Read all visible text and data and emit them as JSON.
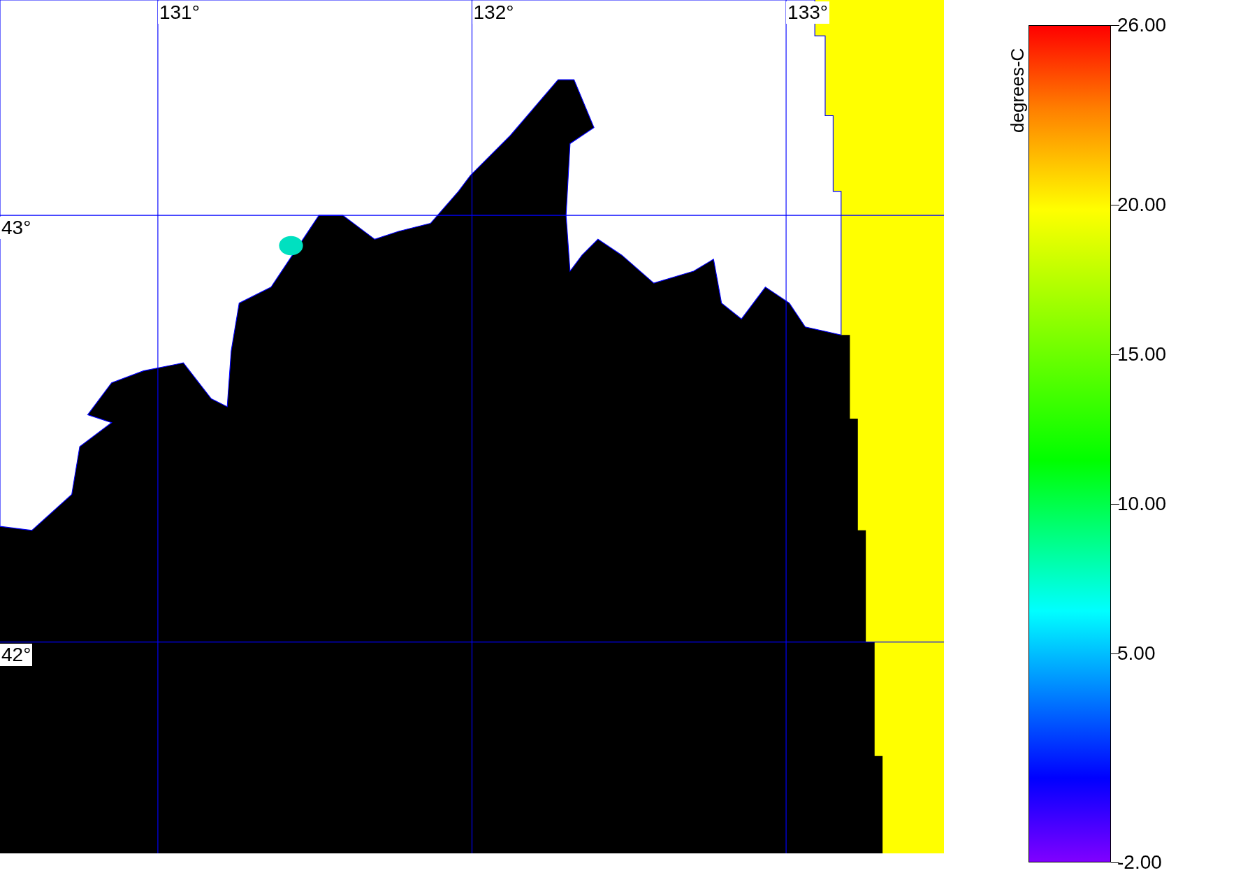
{
  "map": {
    "lon_labels": [
      "131°",
      "132°",
      "133°"
    ],
    "lat_labels": [
      "43°",
      "42°"
    ]
  },
  "colorbar": {
    "title": "degrees-C",
    "ticks": [
      "26.00",
      "20.00",
      "15.00",
      "10.00",
      "5.00",
      "-2.00"
    ]
  }
}
